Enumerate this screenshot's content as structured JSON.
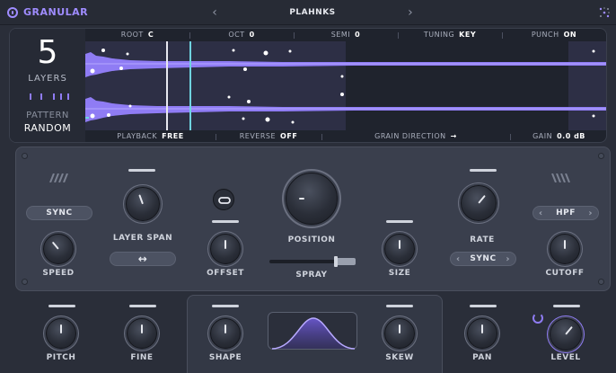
{
  "header": {
    "brand": "GRANULAR",
    "preset_name": "PLAHNKS",
    "prev": "‹",
    "next": "›"
  },
  "display": {
    "layers_count": "5",
    "layers_label": "LAYERS",
    "pattern_label": "PATTERN",
    "pattern_value": "RANDOM",
    "top_params": [
      {
        "key": "ROOT",
        "value": "C"
      },
      {
        "key": "OCT",
        "value": "0"
      },
      {
        "key": "SEMI",
        "value": "0"
      },
      {
        "key": "TUNING",
        "value": "KEY"
      },
      {
        "key": "PUNCH",
        "value": "ON"
      }
    ],
    "bottom_params": [
      {
        "key": "PLAYBACK",
        "value": "FREE"
      },
      {
        "key": "REVERSE",
        "value": "OFF"
      },
      {
        "key": "GRAIN DIRECTION",
        "value": "→"
      },
      {
        "key": "GAIN",
        "value": "0.0 dB"
      }
    ]
  },
  "controls": {
    "sync_left": "SYNC",
    "speed": "SPEED",
    "layer_span": "LAYER SPAN",
    "span_arrow": "↔",
    "offset": "OFFSET",
    "position": "POSITION",
    "spray": "SPRAY",
    "size": "SIZE",
    "rate": "RATE",
    "sync_right": "SYNC",
    "filter_type": "HPF",
    "cutoff": "CUTOFF",
    "pitch": "PITCH",
    "fine": "FINE",
    "shape": "SHAPE",
    "skew": "SKEW",
    "pan": "PAN",
    "level": "LEVEL"
  },
  "colors": {
    "accent": "#9f8cff",
    "waveform": "#8f7cf4",
    "playhead": "#ffffff",
    "marker": "#6fd3e0"
  }
}
